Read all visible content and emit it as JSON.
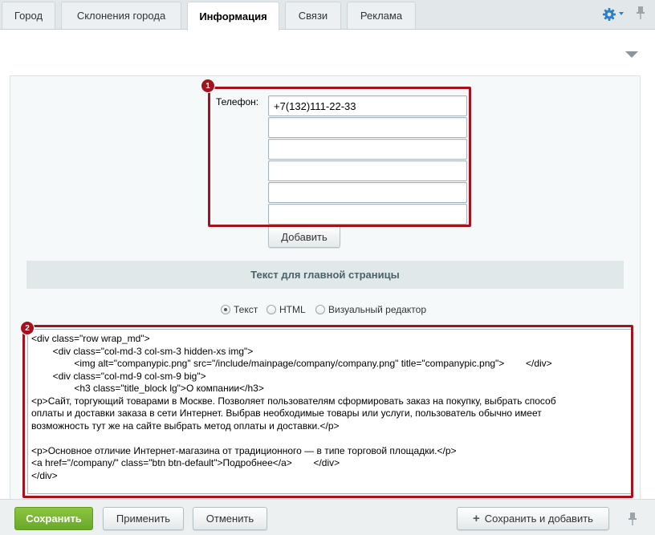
{
  "tabs": [
    {
      "label": "Город"
    },
    {
      "label": "Склонения города"
    },
    {
      "label": "Информация"
    },
    {
      "label": "Связи"
    },
    {
      "label": "Реклама"
    }
  ],
  "phone": {
    "label": "Телефон:",
    "values": [
      "+7(132)111-22-33",
      "",
      "",
      "",
      "",
      ""
    ],
    "add_button": "Добавить"
  },
  "markers": {
    "first": "1",
    "second": "2"
  },
  "section": {
    "title": "Текст для главной страницы"
  },
  "editor_modes": [
    {
      "label": "Текст",
      "checked": true
    },
    {
      "label": "HTML",
      "checked": false
    },
    {
      "label": "Визуальный редактор",
      "checked": false
    }
  ],
  "code_lines": [
    "<div class=\"row wrap_md\">",
    "        <div class=\"col-md-3 col-sm-3 hidden-xs img\">",
    "                <img alt=\"companypic.png\" src=\"/include/mainpage/company/company.png\" title=\"companypic.png\">        </div>",
    "        <div class=\"col-md-9 col-sm-9 big\">",
    "                <h3 class=\"title_block lg\">О компании</h3>",
    "<p>Сайт, торгующий товарами в Москве. Позволяет пользователям сформировать заказ на покупку, выбрать способ",
    "оплаты и доставки заказа в сети Интернет. Выбрав необходимые товары или услуги, пользователь обычно имеет",
    "возможность тут же на сайте выбрать метод оплаты и доставки.</p>",
    "",
    "<p>Основное отличие Интернет-магазина от традиционного — в типе торговой площадки.</p>",
    "<a href=\"/company/\" class=\"btn btn-default\">Подробнее</a>        </div>",
    "</div>"
  ],
  "footer": {
    "save": "Сохранить",
    "apply": "Применить",
    "cancel": "Отменить",
    "save_add": "Сохранить и добавить"
  },
  "colors": {
    "accent_green": "#7ab834",
    "highlight_red": "#a3131e",
    "gear_blue": "#2f7fc4"
  }
}
